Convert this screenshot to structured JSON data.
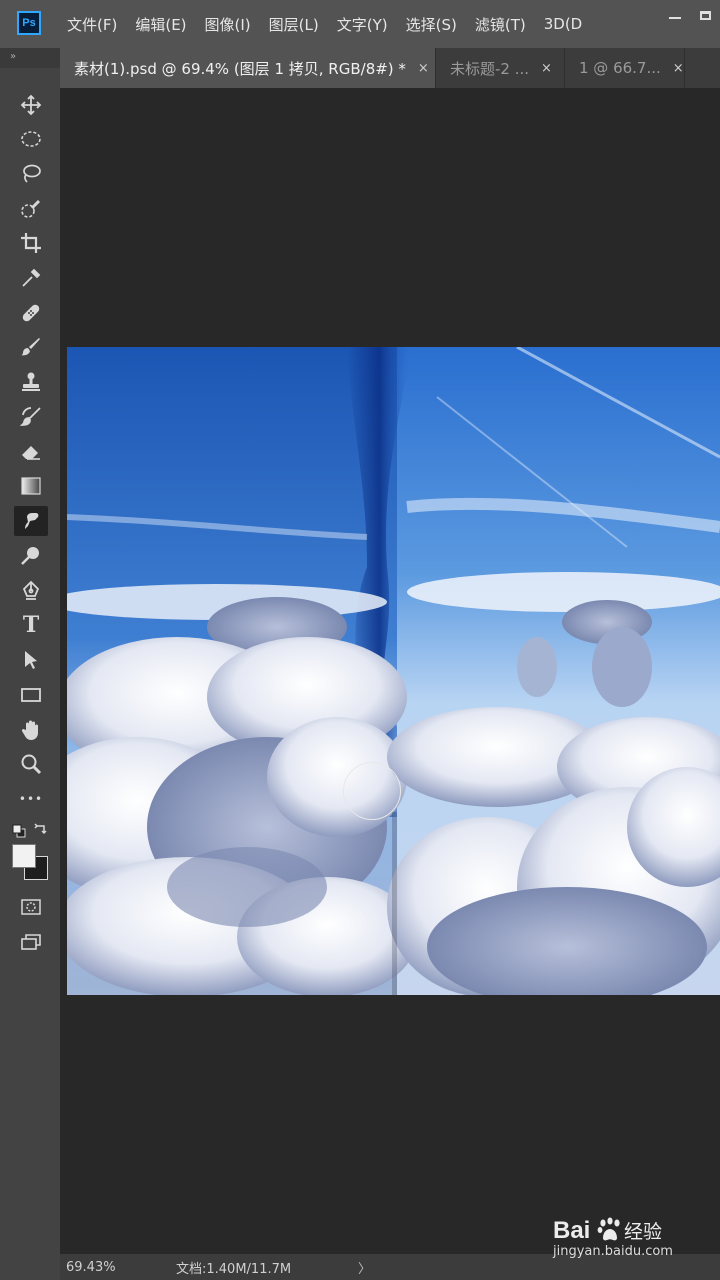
{
  "app": {
    "logo": "Ps"
  },
  "menu": [
    "文件(F)",
    "编辑(E)",
    "图像(I)",
    "图层(L)",
    "文字(Y)",
    "选择(S)",
    "滤镜(T)",
    "3D(D"
  ],
  "tabs": [
    {
      "label": "素材(1).psd @ 69.4% (图层 1 拷贝, RGB/8#) *",
      "active": true,
      "close": "×"
    },
    {
      "label": "未标题-2 ...",
      "active": false,
      "close": "×"
    },
    {
      "label": "1 @ 66.7...",
      "active": false,
      "close": "×"
    }
  ],
  "toolstrip": {
    "collapse_glyph": "»",
    "tools": [
      "move-icon",
      "elliptical-marquee-icon",
      "lasso-icon",
      "quick-selection-icon",
      "crop-icon",
      "eyedropper-icon",
      "healing-brush-icon",
      "brush-icon",
      "clone-stamp-icon",
      "history-brush-icon",
      "eraser-icon",
      "gradient-icon",
      "smudge-icon",
      "dodge-icon",
      "pen-icon",
      "type-icon",
      "path-selection-icon",
      "rectangle-icon",
      "hand-icon",
      "zoom-icon",
      "more-tools-icon"
    ],
    "active_tool": "smudge-icon",
    "foreground_color": "#f2f2f2",
    "background_color": "#1e1e1e",
    "type_glyph": "T",
    "more_glyph": "•••"
  },
  "status": {
    "zoom": "69.43%",
    "doc": "文档:1.40M/11.7M",
    "arrow": "〉"
  },
  "watermark": {
    "brand_left": "Bai",
    "brand_right": "经验",
    "url": "jingyan.baidu.com"
  }
}
